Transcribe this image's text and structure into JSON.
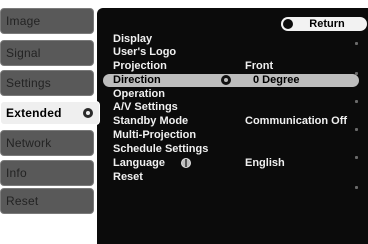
{
  "tabs": [
    {
      "label": "Image",
      "active": false
    },
    {
      "label": "Signal",
      "active": false
    },
    {
      "label": "Settings",
      "active": false
    },
    {
      "label": "Extended",
      "active": true
    },
    {
      "label": "Network",
      "active": false
    },
    {
      "label": "Info",
      "active": false
    },
    {
      "label": "Reset",
      "active": false
    }
  ],
  "return_label": "Return",
  "items": [
    {
      "label": "Display",
      "value": ""
    },
    {
      "label": "User's Logo",
      "value": ""
    },
    {
      "label": "Projection",
      "value": "Front"
    },
    {
      "label": "Direction",
      "value": "0 Degree",
      "highlighted": true,
      "icon": "dial-icon"
    },
    {
      "label": "Operation",
      "value": ""
    },
    {
      "label": "A/V Settings",
      "value": ""
    },
    {
      "label": "Standby Mode",
      "value": "Communication Off"
    },
    {
      "label": "Multi-Projection",
      "value": ""
    },
    {
      "label": "Schedule Settings",
      "value": ""
    },
    {
      "label": "Language",
      "value": "English",
      "icon": "globe-icon"
    },
    {
      "label": "Reset",
      "value": ""
    }
  ],
  "colors": {
    "panel_bg": "#0b0b0b",
    "tab_bg": "#595959",
    "tab_active_bg": "#efefef",
    "highlight_bg": "#bdbdbd",
    "text": "#f0f0f0"
  }
}
